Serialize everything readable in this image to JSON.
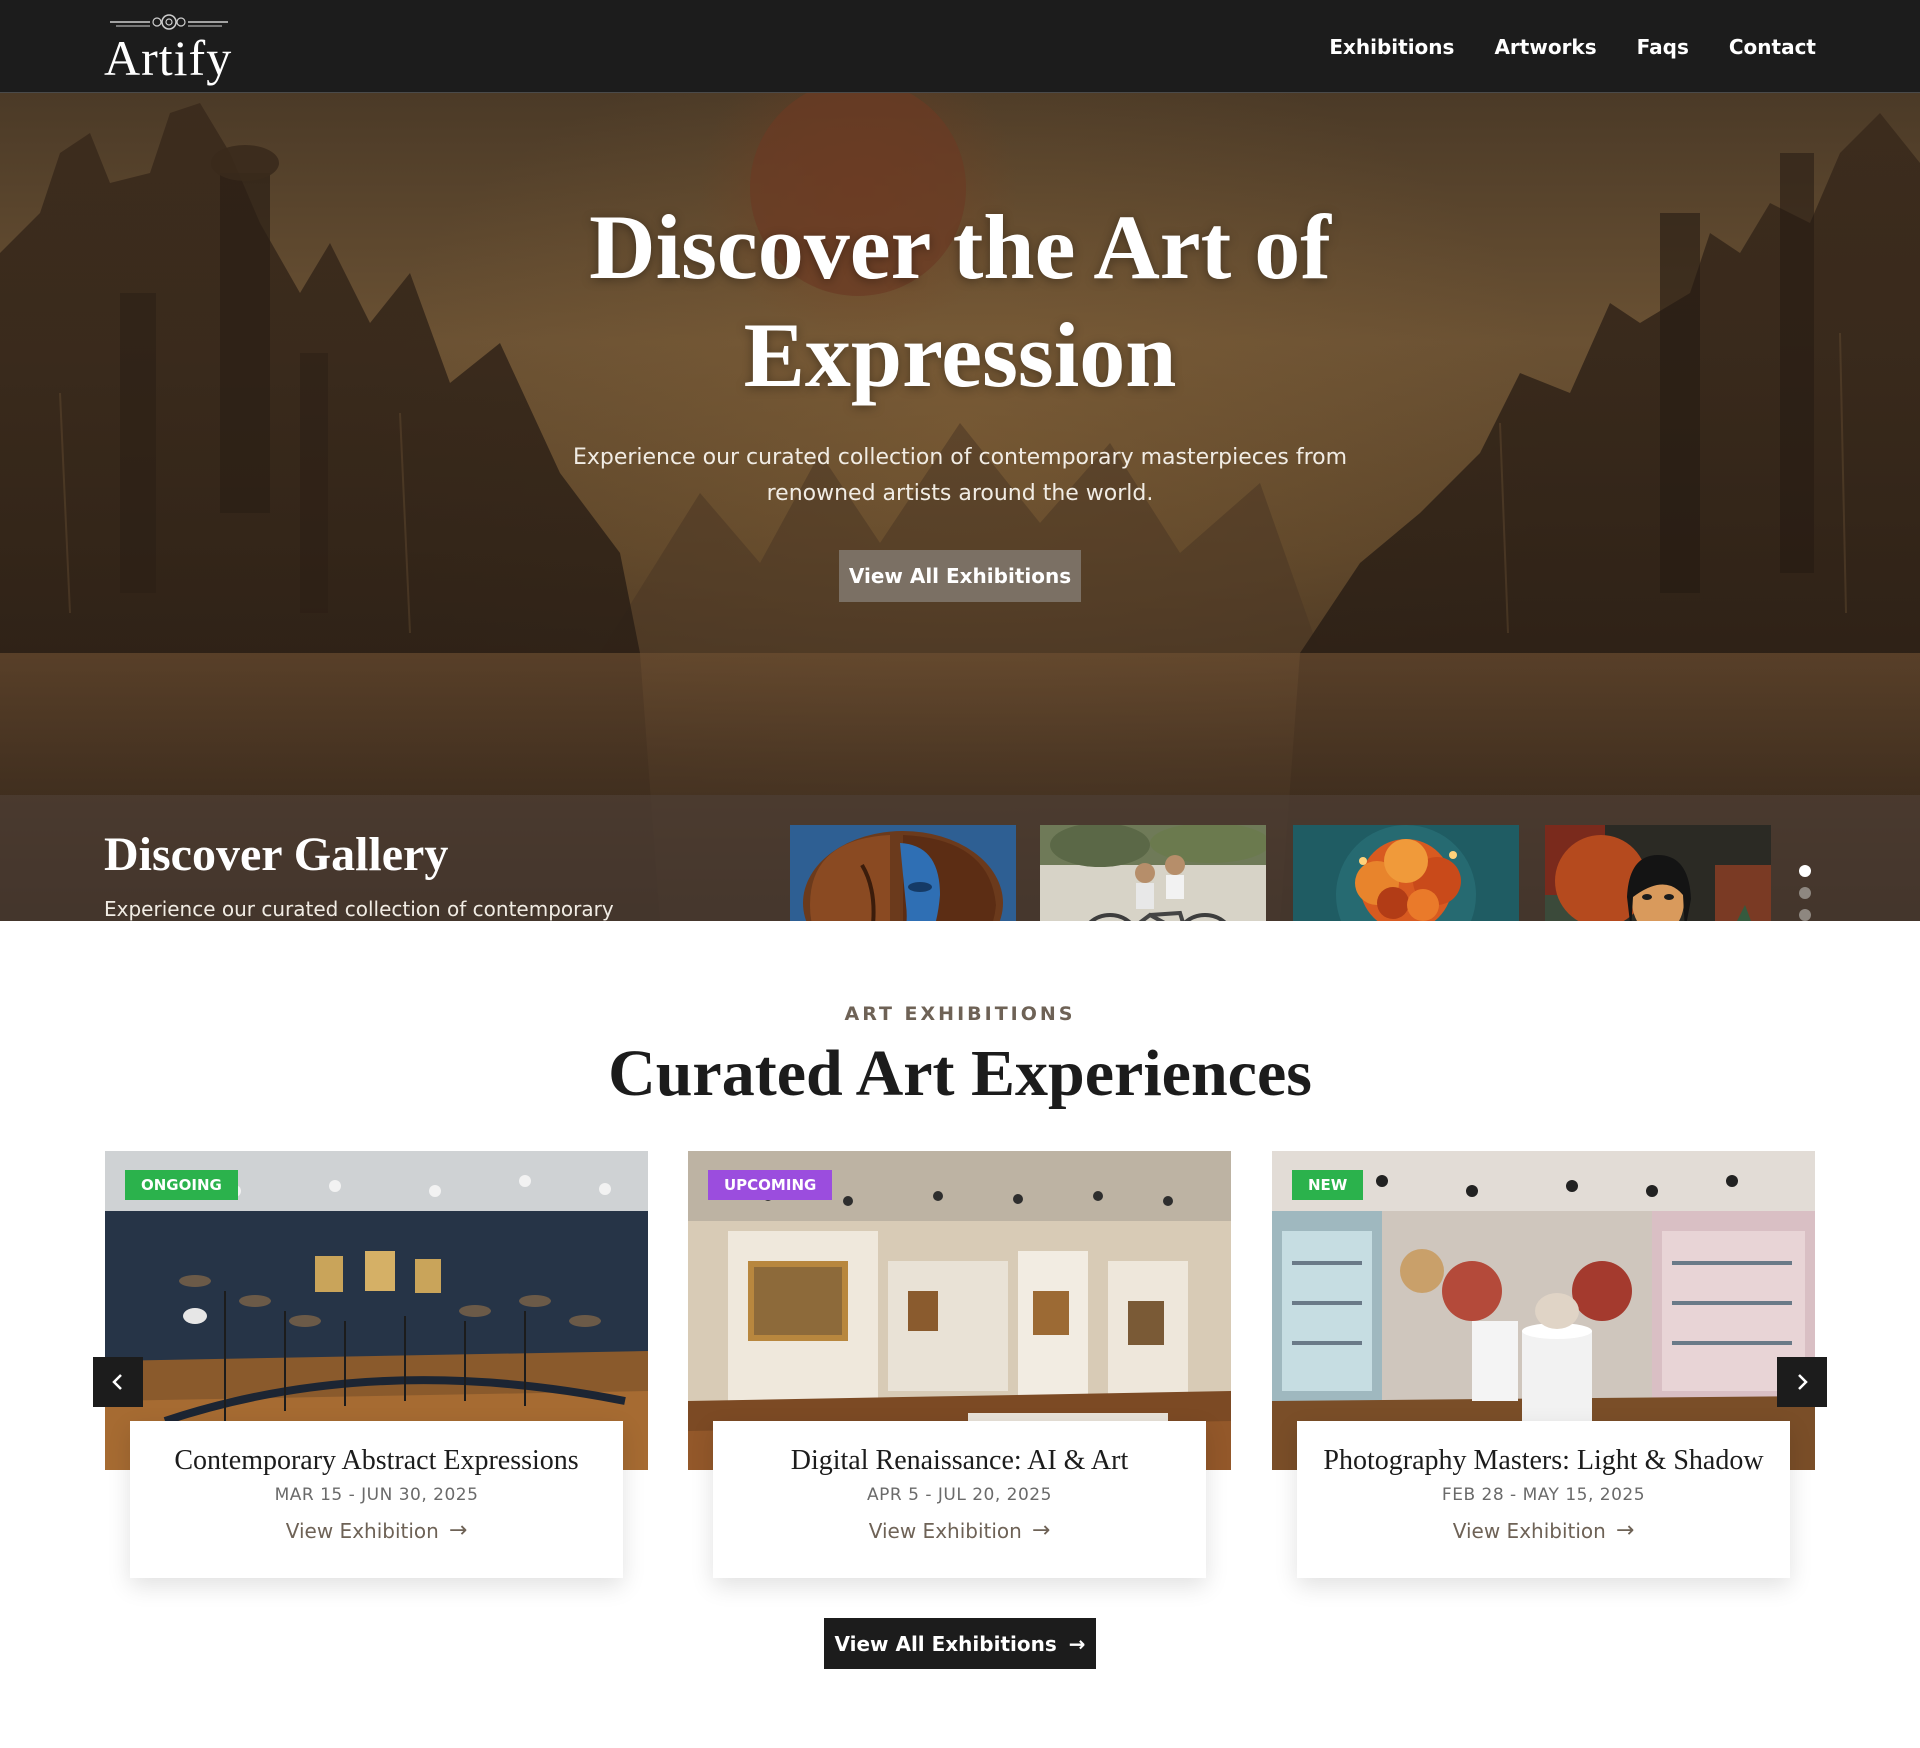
{
  "header": {
    "logo_text": "Artify",
    "nav": [
      "Exhibitions",
      "Artworks",
      "Faqs",
      "Contact"
    ]
  },
  "hero": {
    "title": "Discover the Art of Expression",
    "subtitle": "Experience our curated collection of contemporary masterpieces from renowned artists around the world.",
    "cta_label": "View All Exhibitions"
  },
  "gallery_band": {
    "title": "Discover Gallery",
    "text": "Experience our curated collection of contemporary masterpieces from renowned artists around the world. Experience our curated collection of contemporary.",
    "thumbnails": [
      "wooden-blue-face-sculpture",
      "children-on-bicycle-mural",
      "flowering-tree-painting",
      "cubist-woman-portrait"
    ],
    "active_slide": 1,
    "slide_count": 4
  },
  "exhibitions": {
    "eyebrow": "ART EXHIBITIONS",
    "title": "Curated Art Experiences",
    "cards": [
      {
        "badge": "ONGOING",
        "badge_color": "#2bb24c",
        "title": "Contemporary Abstract Expressions",
        "date": "MAR 15 - JUN 30, 2025",
        "link": "View Exhibition"
      },
      {
        "badge": "UPCOMING",
        "badge_color": "#9b4dde",
        "title": "Digital Renaissance: AI & Art",
        "date": "APR 5 - JUL 20, 2025",
        "link": "View Exhibition"
      },
      {
        "badge": "NEW",
        "badge_color": "#2bb24c",
        "title": "Photography Masters: Light & Shadow",
        "date": "FEB 28 - MAY 15, 2025",
        "link": "View Exhibition"
      }
    ],
    "cta_label": "View All Exhibitions"
  },
  "icons": {
    "prev": "chevron-left-icon",
    "next": "chevron-right-icon",
    "link_arrow": "arrow-right-icon"
  }
}
